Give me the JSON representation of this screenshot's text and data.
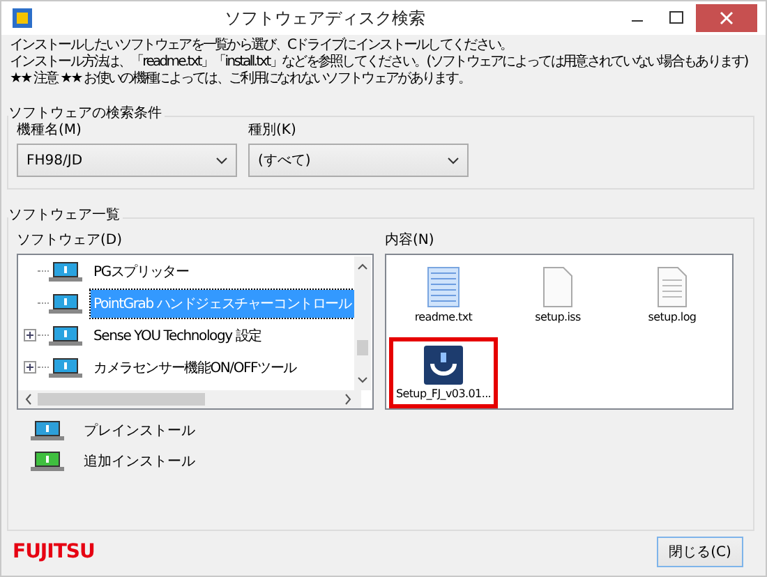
{
  "window": {
    "title": "ソフトウェアディスク検索"
  },
  "instructions": [
    "インストールしたいソフトウェアを一覧から選び、Cドライブにインストールしてください。",
    "インストール方法は、「readme.txt」「install.txt」などを参照してください。(ソフトウェアによっては用意されていない場合もあります)",
    "★★ 注意 ★★ お使いの機種によっては、ご利用になれないソフトウェアがあります。"
  ],
  "search_conditions": {
    "title": "ソフトウェアの検索条件",
    "fields": [
      {
        "label": "機種名(M)",
        "value": "FH98/JD"
      },
      {
        "label": "種別(K)",
        "value": "(すべて)"
      }
    ]
  },
  "software_list": {
    "title": "ソフトウェア一覧",
    "tree_label": "ソフトウェア(D)",
    "content_label": "内容(N)",
    "tree": [
      {
        "label": "PGスプリッター",
        "selected": false,
        "expandable": false
      },
      {
        "label": "PointGrab ハンドジェスチャーコントロール",
        "selected": true,
        "expandable": false
      },
      {
        "label": "Sense YOU Technology 設定",
        "selected": false,
        "expandable": true
      },
      {
        "label": "カメラセンサー機能ON/OFFツール",
        "selected": false,
        "expandable": true
      }
    ],
    "files": [
      {
        "name": "readme.txt",
        "kind": "text",
        "highlighted": false
      },
      {
        "name": "setup.iss",
        "kind": "blank",
        "highlighted": false
      },
      {
        "name": "setup.log",
        "kind": "log",
        "highlighted": false
      },
      {
        "name": "Setup_FJ_v03.01...",
        "kind": "app",
        "highlighted": true
      }
    ],
    "legend": [
      {
        "label": "プレインストール",
        "kind": "preinstall"
      },
      {
        "label": "追加インストール",
        "kind": "additional"
      }
    ]
  },
  "footer": {
    "logo": "FUJITSU",
    "close_button": "閉じる(C)"
  }
}
